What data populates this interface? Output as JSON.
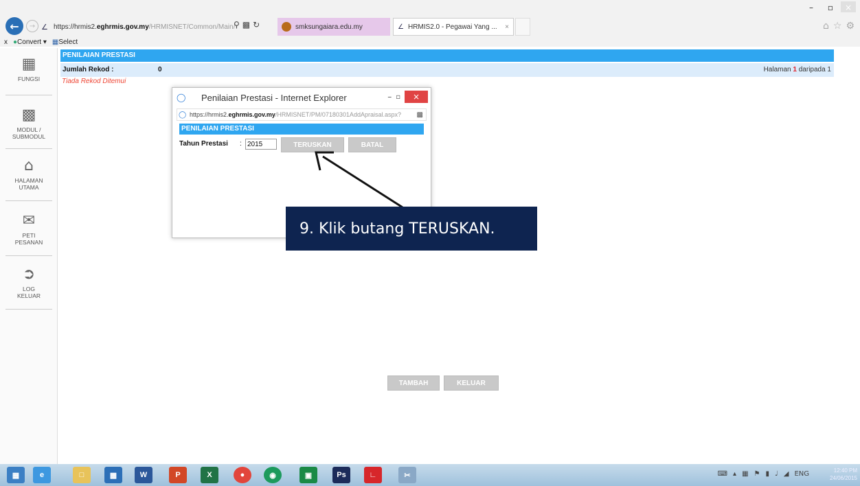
{
  "browser": {
    "url_prefix": "https://hrmis2.",
    "url_domain": "eghrmis.gov.my",
    "url_path": "/HRMISNET/Common/Main/",
    "tab1_label": "smksungaiara.edu.my",
    "tab2_label": "HRMIS2.0 - Pegawai Yang ...",
    "tab2_close": "×",
    "cmd_convert": "Convert",
    "cmd_select": "Select"
  },
  "window_controls": {
    "minimize": "–",
    "maximize": "▫",
    "close": "×"
  },
  "sidebar": {
    "items": [
      {
        "label": "FUNGSI",
        "icon": "grid-icon"
      },
      {
        "label": "MODUL / SUBMODUL",
        "icon": "modules-icon"
      },
      {
        "label": "HALAMAN UTAMA",
        "icon": "home-icon"
      },
      {
        "label": "PETI PESANAN",
        "icon": "mail-icon"
      },
      {
        "label": "LOG KELUAR",
        "icon": "logout-icon"
      }
    ]
  },
  "main": {
    "header": "PENILAIAN PRESTASI",
    "jumlah_label": "Jumlah Rekod :",
    "jumlah_value": "0",
    "halaman_prefix": "Halaman",
    "halaman_page": "1",
    "halaman_suffix": "daripada 1",
    "tiada": "Tiada Rekod Ditemui",
    "tambah_label": "TAMBAH",
    "keluar_label": "KELUAR"
  },
  "popup": {
    "title": "Penilaian Prestasi - Internet Explorer",
    "url_prefix": "https://hrmis2.",
    "url_domain": "eghrmis.gov.my",
    "url_path": "/HRMISNET/PM/07180301AddApraisal.aspx?",
    "header": "PENILAIAN PRESTASI",
    "field_label": "Tahun Prestasi",
    "field_colon": ":",
    "field_value": "2015",
    "teruskan_label": "TERUSKAN",
    "batal_label": "BATAL"
  },
  "callout": {
    "text": "9.  Klik butang TERUSKAN."
  },
  "taskbar": {
    "apps": [
      "windows-start-icon",
      "ie-icon",
      "explorer-icon",
      "monitor-icon",
      "word-icon",
      "powerpoint-icon",
      "excel-icon",
      "chrome-icon",
      "app-green-icon",
      "store-icon",
      "photoshop-icon",
      "pdf-icon",
      "snipping-icon"
    ],
    "lang": "ENG",
    "time": "12:40 PM",
    "date": "24/06/2015"
  }
}
